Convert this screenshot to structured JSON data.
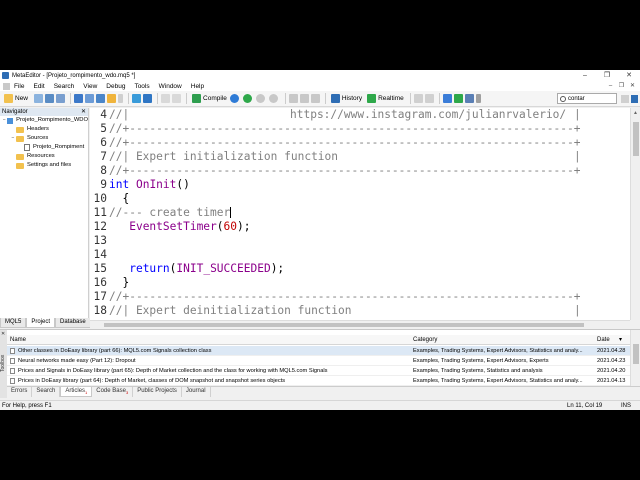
{
  "window": {
    "title": "MetaEditor - [Projeto_rompimento_wdo.mq5 *]",
    "controls": [
      "–",
      "❐",
      "✕"
    ]
  },
  "menu": {
    "items": [
      "File",
      "Edit",
      "Search",
      "View",
      "Debug",
      "Tools",
      "Window",
      "Help"
    ],
    "mdi_controls": [
      "–",
      "❐",
      "✕"
    ]
  },
  "toolbar": {
    "new_label": "New",
    "compile_label": "Compile",
    "history_label": "History",
    "realtime_label": "Realtime",
    "search_value": "contar",
    "accent": "#2e6db4"
  },
  "navigator": {
    "title": "Navigator",
    "close": "✕",
    "items": [
      {
        "label": "Projeto_Rompimento_WDO",
        "level": 0,
        "icon": "pc-icon",
        "expander": "−"
      },
      {
        "label": "Headers",
        "level": 1,
        "icon": "folder-icon",
        "expander": ""
      },
      {
        "label": "Sources",
        "level": 1,
        "icon": "folder-icon",
        "expander": "−"
      },
      {
        "label": "Projeto_Rompiment",
        "level": 2,
        "icon": "file-icon",
        "expander": ""
      },
      {
        "label": "Resources",
        "level": 1,
        "icon": "folder-icon",
        "expander": ""
      },
      {
        "label": "Settings and files",
        "level": 1,
        "icon": "folder-icon",
        "expander": ""
      }
    ],
    "tabs": [
      "MQL5",
      "Project",
      "Database"
    ],
    "active_tab": "Project"
  },
  "editor": {
    "lines": [
      {
        "num": "4",
        "url": "https://www.instagram.com/julianrvalerio/"
      },
      {
        "num": "5",
        "text": "//+------------------------------------------------------------------+"
      },
      {
        "num": "6",
        "text": "//+------------------------------------------------------------------+"
      },
      {
        "num": "7",
        "comment": "//| Expert initialization function"
      },
      {
        "num": "8",
        "text": "//+------------------------------------------------------------------+"
      },
      {
        "num": "9",
        "kw": "int",
        "fn": "OnInit",
        "rest": "()"
      },
      {
        "num": "10",
        "text": "  {"
      },
      {
        "num": "11",
        "comment": "//--- create timer"
      },
      {
        "num": "12",
        "fn": "EventSetTimer",
        "open": "(",
        "num_val": "60",
        "close": ");"
      },
      {
        "num": "13",
        "text": ""
      },
      {
        "num": "14",
        "text": ""
      },
      {
        "num": "15",
        "kw": "return",
        "open": "(",
        "const": "INIT_SUCCEEDED",
        "close": ");"
      },
      {
        "num": "16",
        "text": "  }"
      },
      {
        "num": "17",
        "text": "//+------------------------------------------------------------------+"
      },
      {
        "num": "18",
        "comment": "//| Expert deinitialization function"
      }
    ],
    "comment_prefix": "//|",
    "pipe": "|"
  },
  "toolbox": {
    "side_label": "Toolbox",
    "close": "✕",
    "columns": {
      "name": "Name",
      "category": "Category",
      "date": "Date"
    },
    "rows": [
      {
        "name": "Other classes in DoEasy library (part 66): MQL5.com Signals collection class",
        "category": "Examples, Trading Systems, Expert Advisors, Statistics and analy...",
        "date": "2021.04.28"
      },
      {
        "name": "Neural networks made easy (Part 12): Dropout",
        "category": "Examples, Trading Systems, Expert Advisors, Experts",
        "date": "2021.04.23"
      },
      {
        "name": "Prices and Signals in DoEasy library (part 65): Depth of Market collection and the class for working with MQL5.com Signals",
        "category": "Examples, Trading Systems, Statistics and analysis",
        "date": "2021.04.20"
      },
      {
        "name": "Prices in DoEasy library (part 64): Depth of Market, classes of DOM snapshot and snapshot series objects",
        "category": "Examples, Trading Systems, Expert Advisors, Statistics and analy...",
        "date": "2021.04.13"
      }
    ],
    "tabs": [
      {
        "label": "Errors",
        "badge": ""
      },
      {
        "label": "Search",
        "badge": ""
      },
      {
        "label": "Articles",
        "badge": "1"
      },
      {
        "label": "Code Base",
        "badge": "3"
      },
      {
        "label": "Public Projects",
        "badge": ""
      },
      {
        "label": "Journal",
        "badge": ""
      }
    ],
    "active_tab": "Articles"
  },
  "status": {
    "help": "For Help, press F1",
    "position": "Ln 11, Col 19",
    "mode": "INS"
  }
}
